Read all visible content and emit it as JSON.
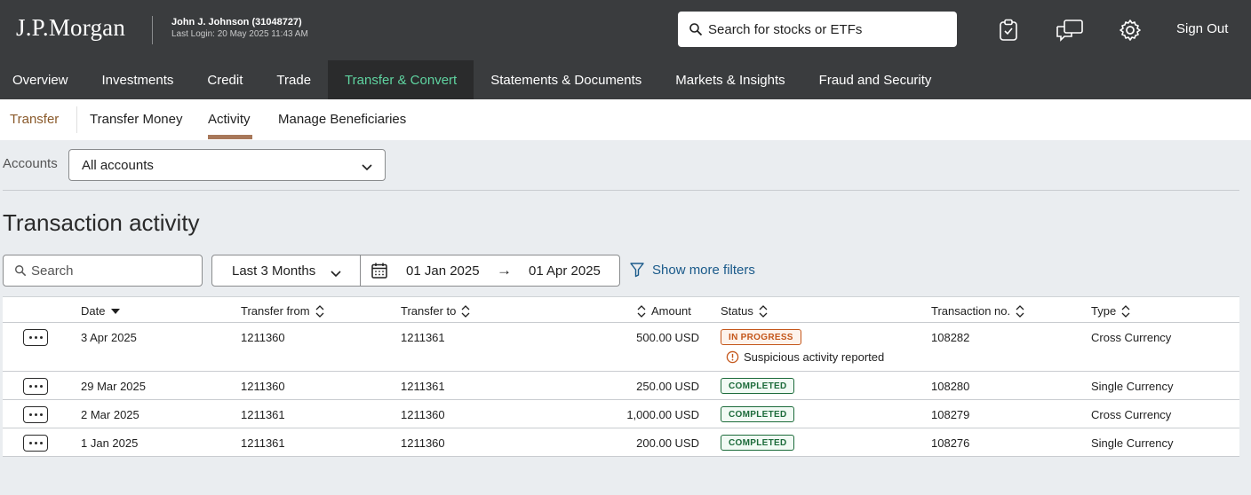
{
  "header": {
    "logo": "J.P.Morgan",
    "user_name": "John J. Johnson (31048727)",
    "last_login": "Last Login: 20 May 2025 11:43 AM",
    "search_placeholder": "Search for stocks or ETFs",
    "sign_out": "Sign Out",
    "icons": [
      "clipboard-check-icon",
      "chat-icon",
      "gear-icon"
    ]
  },
  "main_nav": [
    {
      "label": "Overview",
      "active": false
    },
    {
      "label": "Investments",
      "active": false
    },
    {
      "label": "Credit",
      "active": false
    },
    {
      "label": "Trade",
      "active": false
    },
    {
      "label": "Transfer & Convert",
      "active": true
    },
    {
      "label": "Statements & Documents",
      "active": false
    },
    {
      "label": "Markets & Insights",
      "active": false
    },
    {
      "label": "Fraud and Security",
      "active": false
    }
  ],
  "sub_nav": {
    "title": "Transfer",
    "tabs": [
      "Transfer Money",
      "Activity",
      "Manage Beneficiaries"
    ],
    "active_tab": "Activity"
  },
  "accounts": {
    "label": "Accounts",
    "selected": "All accounts"
  },
  "page_title": "Transaction activity",
  "filters": {
    "search_placeholder": "Search",
    "preset": "Last 3 Months",
    "date_from": "01 Jan 2025",
    "arrow": "→",
    "date_to": "01 Apr 2025",
    "more_filters": "Show more filters"
  },
  "table": {
    "columns": {
      "date": "Date",
      "from": "Transfer from",
      "to": "Transfer to",
      "amount": "Amount",
      "status": "Status",
      "txn": "Transaction no.",
      "type": "Type"
    },
    "rows": [
      {
        "date": "3 Apr 2025",
        "from": "1211360",
        "to": "1211361",
        "amount": "500.00 USD",
        "status": "IN PROGRESS",
        "status_kind": "progress",
        "note": "Suspicious activity reported",
        "txn": "108282",
        "type": "Cross Currency"
      },
      {
        "date": "29 Mar 2025",
        "from": "1211360",
        "to": "1211361",
        "amount": "250.00 USD",
        "status": "COMPLETED",
        "status_kind": "done",
        "note": "",
        "txn": "108280",
        "type": "Single Currency"
      },
      {
        "date": "2 Mar 2025",
        "from": "1211361",
        "to": "1211360",
        "amount": "1,000.00 USD",
        "status": "COMPLETED",
        "status_kind": "done",
        "note": "",
        "txn": "108279",
        "type": "Cross Currency"
      },
      {
        "date": "1 Jan 2025",
        "from": "1211361",
        "to": "1211360",
        "amount": "200.00 USD",
        "status": "COMPLETED",
        "status_kind": "done",
        "note": "",
        "txn": "108276",
        "type": "Single Currency"
      }
    ]
  }
}
